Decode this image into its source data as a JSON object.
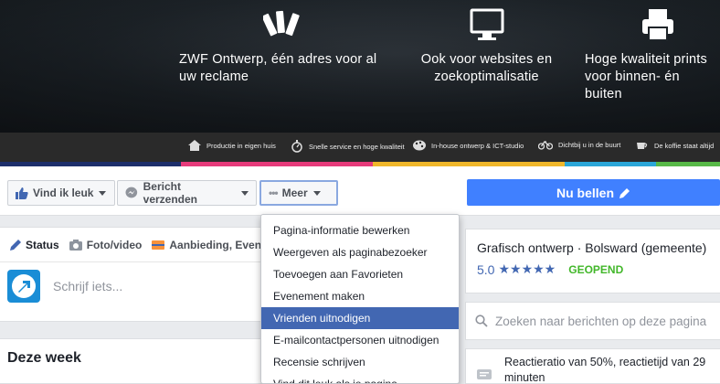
{
  "cover": {
    "features": [
      {
        "icon": "swatch-fan-icon",
        "text": "ZWF Ontwerp, één adres voor al uw reclame"
      },
      {
        "icon": "monitor-icon",
        "text": "Ook voor websites en zoekoptimalisatie"
      },
      {
        "icon": "printer-icon",
        "text": "Hoge kwaliteit prints voor binnen- én buiten"
      }
    ],
    "ribbon": [
      {
        "icon": "house-icon",
        "text": "Productie in eigen huis"
      },
      {
        "icon": "stopwatch-icon",
        "text": "Snelle service en hoge kwaliteit"
      },
      {
        "icon": "palette-icon",
        "text": "In-house ontwerp & ICT-studio"
      },
      {
        "icon": "bicycle-icon",
        "text": "Dichtbij u in de buurt"
      },
      {
        "icon": "coffee-cup-icon",
        "text": "De koffie staat altijd"
      }
    ],
    "stripe_colors": [
      "#1d2f6b",
      "#e63a7a",
      "#f0b72a",
      "#2aa6d8",
      "#57b947"
    ]
  },
  "actions": {
    "like": "Vind ik leuk",
    "message": "Bericht verzenden",
    "more": "Meer",
    "call": "Nu bellen"
  },
  "composer": {
    "tabs": [
      "Status",
      "Foto/video",
      "Aanbieding, Even"
    ],
    "placeholder": "Schrijf iets..."
  },
  "week": {
    "title": "Deze week"
  },
  "info": {
    "category": "Grafisch ontwerp · Bolsward (gemeente)",
    "rating": "5.0",
    "stars": "★★★★★",
    "status": "GEOPEND"
  },
  "search": {
    "placeholder": "Zoeken naar berichten op deze pagina"
  },
  "response": {
    "text": "Reactieratio van 50%, reactietijd van 29 minuten"
  },
  "menu": {
    "items": [
      "Pagina-informatie bewerken",
      "Weergeven als paginabezoeker",
      "Toevoegen aan Favorieten",
      "Evenement maken",
      "Vrienden uitnodigen",
      "E-mailcontactpersonen uitnodigen",
      "Recensie schrijven",
      "Vind dit leuk als je pagina"
    ],
    "highlighted_index": 4
  },
  "colors": {
    "accent": "#4267b2",
    "call_button": "#4080ff",
    "open_status": "#42b72a"
  }
}
